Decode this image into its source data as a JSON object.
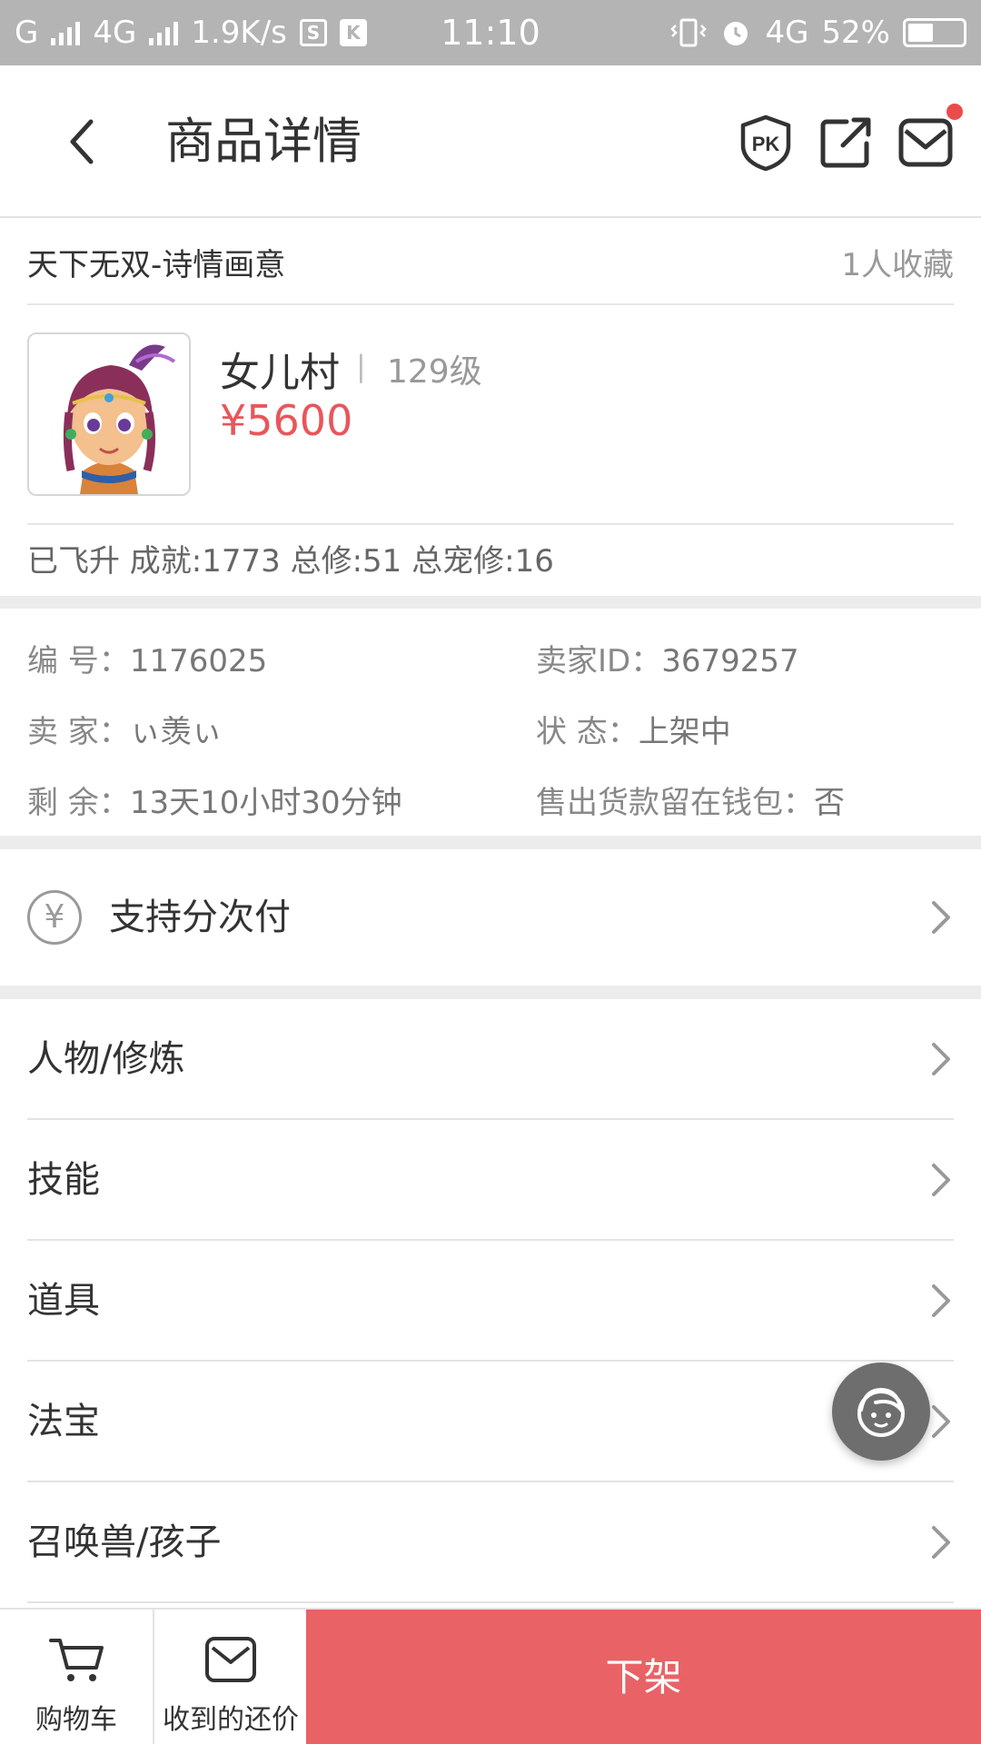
{
  "status_bar": {
    "carrier": "G",
    "network": "4G",
    "speed": "1.9K/s",
    "app_icon_1": "S",
    "app_icon_2": "K",
    "time": "11:10",
    "network_right": "4G",
    "battery_percent": "52%",
    "battery_level": 0.52
  },
  "header": {
    "title": "商品详情",
    "icons": [
      "back-icon",
      "pk-icon",
      "share-icon",
      "mail-icon"
    ]
  },
  "listing": {
    "name": "天下无双-诗情画意",
    "favorites": "1人收藏"
  },
  "product": {
    "school": "女儿村",
    "separator": "|",
    "level": "129级",
    "price": "¥5600",
    "stats": "已飞升 成就:1773 总修:51 总宠修:16"
  },
  "info": {
    "id_label": "编  号：",
    "id_value": "1176025",
    "seller_id_label": "卖家ID：",
    "seller_id_value": "3679257",
    "seller_label": "卖  家：",
    "seller_value": "ぃ羡ぃ",
    "status_label": "状  态：",
    "status_value": "上架中",
    "remaining_label": "剩  余：",
    "remaining_value": "13天10小时30分钟",
    "wallet_label": "售出货款留在钱包：",
    "wallet_value": "否"
  },
  "installment": {
    "symbol": "¥",
    "label": "支持分次付"
  },
  "menu": [
    {
      "label": "人物/修炼"
    },
    {
      "label": "技能"
    },
    {
      "label": "道具"
    },
    {
      "label": "法宝"
    },
    {
      "label": "召唤兽/孩子"
    }
  ],
  "bottom_bar": {
    "cart_label": "购物车",
    "offers_label": "收到的还价",
    "delist_label": "下架"
  },
  "colors": {
    "accent": "#e86266",
    "price": "#e8565b",
    "status_bar": "#b4b4b4"
  }
}
